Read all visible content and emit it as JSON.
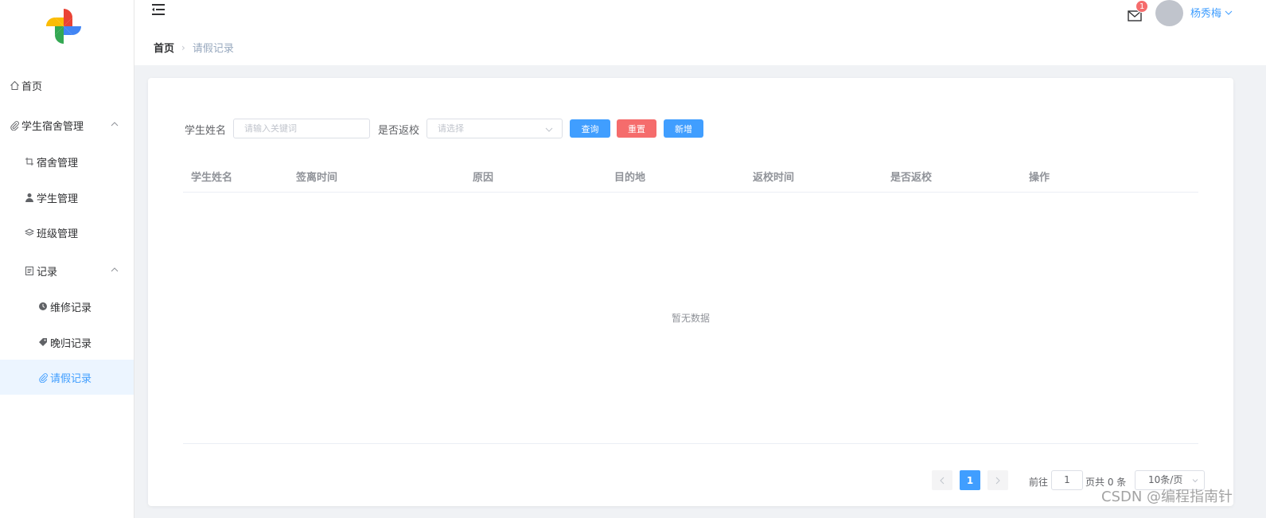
{
  "sidebar": {
    "items": [
      {
        "label": "首页",
        "icon": "home-icon"
      },
      {
        "label": "学生宿舍管理",
        "icon": "paperclip-icon"
      },
      {
        "label": "宿舍管理",
        "icon": "crop-icon"
      },
      {
        "label": "学生管理",
        "icon": "user-icon"
      },
      {
        "label": "班级管理",
        "icon": "layers-icon"
      },
      {
        "label": "记录",
        "icon": "document-icon"
      },
      {
        "label": "维修记录",
        "icon": "clock-icon"
      },
      {
        "label": "晚归记录",
        "icon": "tag-icon"
      },
      {
        "label": "请假记录",
        "icon": "paperclip-icon"
      }
    ]
  },
  "header": {
    "breadcrumb": {
      "home": "首页",
      "current": "请假记录"
    },
    "notification_count": "1",
    "username": "杨秀梅"
  },
  "filters": {
    "name_label": "学生姓名",
    "name_placeholder": "请输入关键词",
    "return_label": "是否返校",
    "return_placeholder": "请选择",
    "query_button": "查询",
    "reset_button": "重置",
    "add_button": "新增"
  },
  "table": {
    "columns": [
      "学生姓名",
      "签离时间",
      "原因",
      "目的地",
      "返校时间",
      "是否返校",
      "操作"
    ],
    "empty_text": "暂无数据"
  },
  "pagination": {
    "current_page": "1",
    "goto_label": "前往",
    "goto_value": "1",
    "total_label": "页共 0 条",
    "page_size": "10条/页"
  },
  "watermark": "CSDN @编程指南针",
  "colors": {
    "primary": "#409eff",
    "danger": "#f56c6c",
    "active_bg": "#ecf5ff"
  }
}
